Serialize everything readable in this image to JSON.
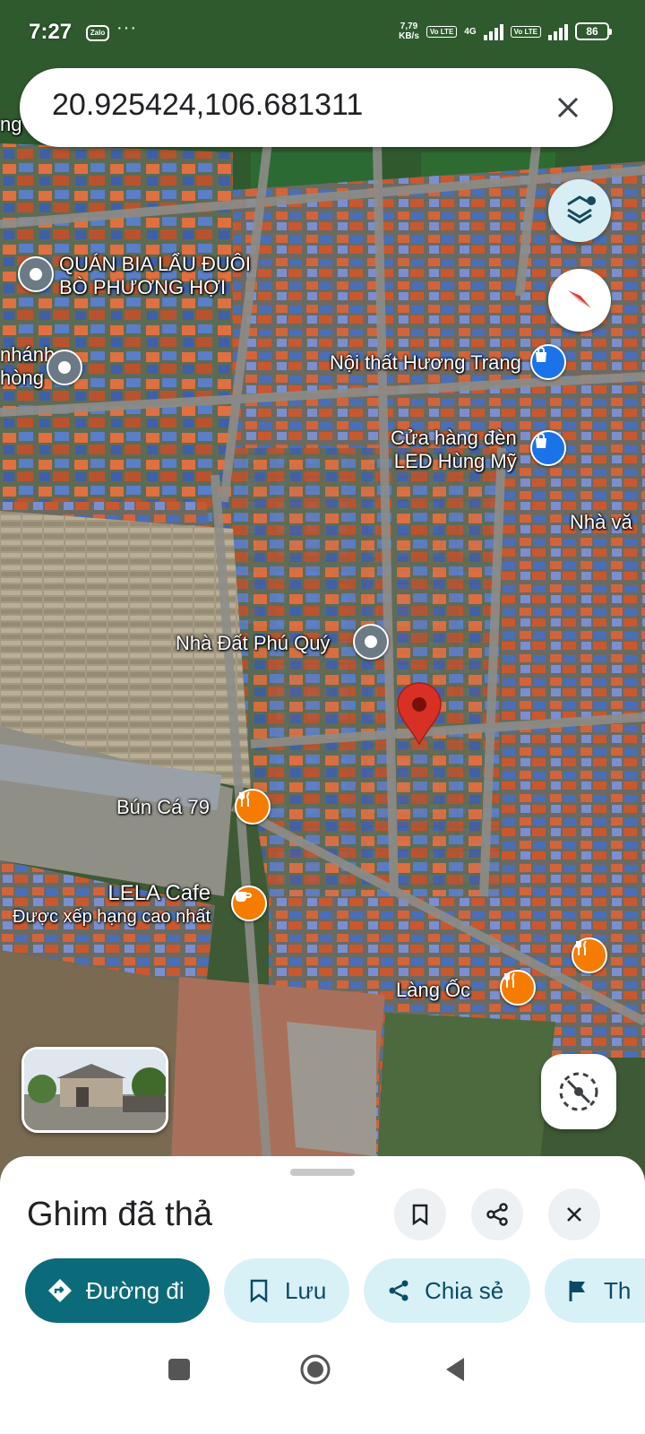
{
  "status_bar": {
    "time": "7:27",
    "app_icon": "Zalo",
    "more_dots": "···",
    "net_speed_value": "7,79",
    "net_speed_unit": "KB/s",
    "volte_1": "Vo LTE",
    "net_type": "4G",
    "volte_2": "Vo LTE",
    "battery": "86"
  },
  "search": {
    "query": "20.925424,106.681311",
    "clear_icon": "close-icon"
  },
  "map": {
    "labels": [
      {
        "id": "quan-bia",
        "line1": "QUÁN BIA LẨU ĐUÔI",
        "line2": "BÒ PHƯƠNG HỢI",
        "pin": "grey"
      },
      {
        "id": "chanh-phong",
        "line1": "nhánh",
        "line2": "hòng",
        "pin": "grey"
      },
      {
        "id": "noi-that",
        "line1": "Nội thất Hương Trang",
        "pin": "blue"
      },
      {
        "id": "cua-hang-den",
        "line1": "Cửa hàng đèn",
        "line2": "LED Hùng Mỹ",
        "pin": "blue"
      },
      {
        "id": "nha-va",
        "line1": "Nhà vă"
      },
      {
        "id": "nha-dat",
        "line1": "Nhà Đất Phú Quý",
        "pin": "grey"
      },
      {
        "id": "bun-ca",
        "line1": "Bún Cá 79",
        "pin": "orange-restaurant"
      },
      {
        "id": "lela",
        "line1": "LELA Cafe",
        "line2": "Được xếp hạng cao nhất",
        "pin": "orange-cafe"
      },
      {
        "id": "lang-oc",
        "line1": "Làng Ốc",
        "pin": "orange-restaurant"
      }
    ],
    "left_edge_label": "ng",
    "dropped_pin_color": "#d93025"
  },
  "sheet": {
    "title": "Ghim đã thả",
    "chips": {
      "directions": "Đường đi",
      "save": "Lưu",
      "share": "Chia sẻ",
      "label": "Th"
    }
  },
  "colors": {
    "accent": "#0b6b7a",
    "chip_secondary": "#d8f1f6",
    "layers_button": "#d7eef5",
    "blue_pin": "#1a73e8",
    "orange_pin": "#f57c00"
  }
}
